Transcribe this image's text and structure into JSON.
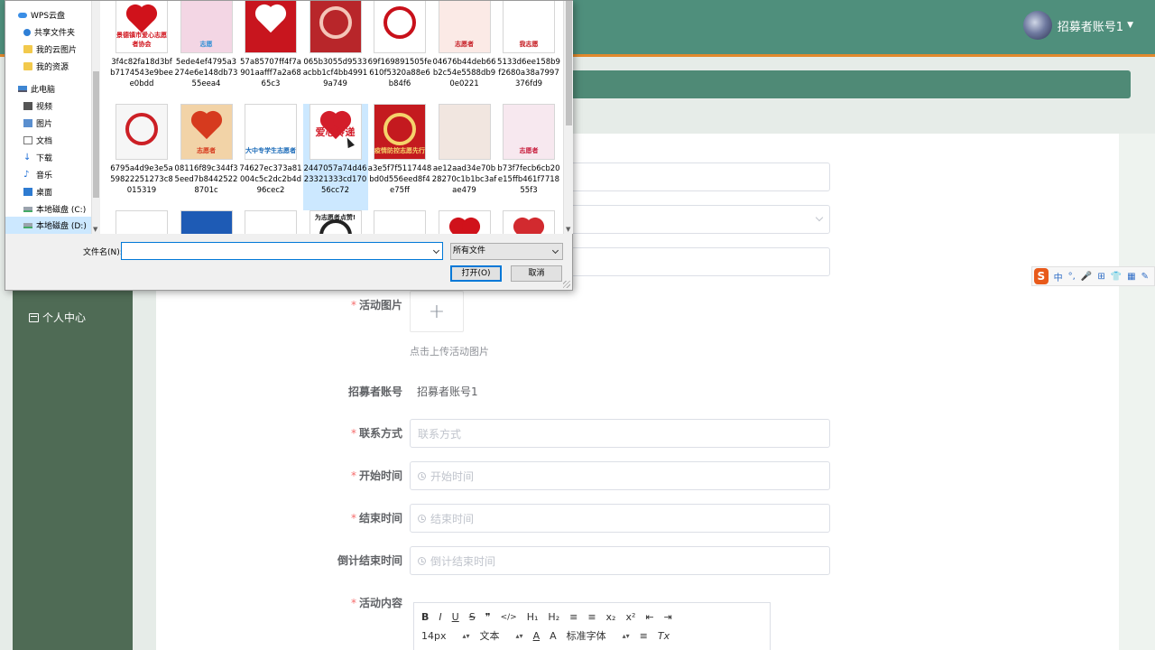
{
  "app": {
    "account_name": "招募者账号1",
    "sidebar_item": "个人中心"
  },
  "form": {
    "image_label": "活动图片",
    "upload_plus": "+",
    "upload_tip": "点击上传活动图片",
    "account_label": "招募者账号",
    "account_value": "招募者账号1",
    "contact_label": "联系方式",
    "contact_placeholder": "联系方式",
    "start_label": "开始时间",
    "start_placeholder": "开始时间",
    "end_label": "结束时间",
    "end_placeholder": "结束时间",
    "countdown_label": "倒计结束时间",
    "countdown_placeholder": "倒计结束时间",
    "content_label": "活动内容",
    "required_mark": "*"
  },
  "editor": {
    "row1": [
      "B",
      "I",
      "U",
      "S",
      "❞",
      "</>",
      "H₁",
      "H₂",
      "≡",
      "≡",
      "x₂",
      "x²",
      "⇤",
      "⇥"
    ],
    "font_size": "14px",
    "text_type": "文本",
    "font_family": "标准字体",
    "color_a": "A",
    "bg_a": "A",
    "align": "≡",
    "clear": "Tx"
  },
  "ime": {
    "logo": "S",
    "items": [
      "中",
      "°,",
      "🎤",
      "⊞",
      "👕",
      "▦",
      "✎"
    ]
  },
  "dialog": {
    "nav": [
      "WPS云盘",
      "共享文件夹",
      "我的云图片",
      "我的资源",
      "此电脑",
      "视频",
      "图片",
      "文档",
      "下载",
      "音乐",
      "桌面",
      "本地磁盘 (C:)",
      "本地磁盘 (D:)"
    ],
    "files": [
      {
        "name": "3f4c82fa18d3bfb7174543e9beee0bdd",
        "caption": "景德镇市爱心志愿者协会"
      },
      {
        "name": "5ede4ef4795a3274e6e148db7355eea4",
        "caption": "志愿"
      },
      {
        "name": "57a85707ff4f7a901aafff7a2a6865c3",
        "caption": ""
      },
      {
        "name": "065b3055d9533acbb1cf4bb49919a749",
        "caption": ""
      },
      {
        "name": "69f169891505fe610f5320a88e6b84f6",
        "caption": ""
      },
      {
        "name": "04676b44deb66b2c54e5588db90e0221",
        "caption": "志愿者"
      },
      {
        "name": "5133d6ee158b9f2680a38a7997376fd9",
        "caption": "我志愿"
      },
      {
        "name": "6795a4d9e3e5a59822251273c8015319",
        "caption": ""
      },
      {
        "name": "08116f89c344f35eed7b84425228701c",
        "caption": "志愿者"
      },
      {
        "name": "74627ec373a81004c5c2dc2b4d96cec2",
        "caption": "大中专学生志愿者"
      },
      {
        "name": "2447057a74d4623321333cd17056cc72",
        "caption": "爱心传递"
      },
      {
        "name": "a3e5f7f5117448bd0d556eed8f4e75ff",
        "caption": "疫情防控志愿先行"
      },
      {
        "name": "ae12aad34e70b28270c1b1bc3afae479",
        "caption": ""
      },
      {
        "name": "b73f7fecb6cb20e15ffb461f771855f3",
        "caption": "志愿者"
      },
      {
        "name": "",
        "caption": ""
      },
      {
        "name": "",
        "caption": ""
      },
      {
        "name": "",
        "caption": ""
      },
      {
        "name": "",
        "caption": "为志愿者点赞!"
      },
      {
        "name": "",
        "caption": ""
      },
      {
        "name": "",
        "caption": ""
      },
      {
        "name": "",
        "caption": ""
      }
    ],
    "filename_label": "文件名(N):",
    "filename_value": "",
    "filetype": "所有文件",
    "open_button": "打开(O)",
    "cancel_button": "取消"
  },
  "colors": {
    "header": "#4f8f7c",
    "accent_line": "#e3892d",
    "sidebar": "#4f6b55",
    "required": "#f56c6c",
    "selection": "#cce8ff"
  }
}
